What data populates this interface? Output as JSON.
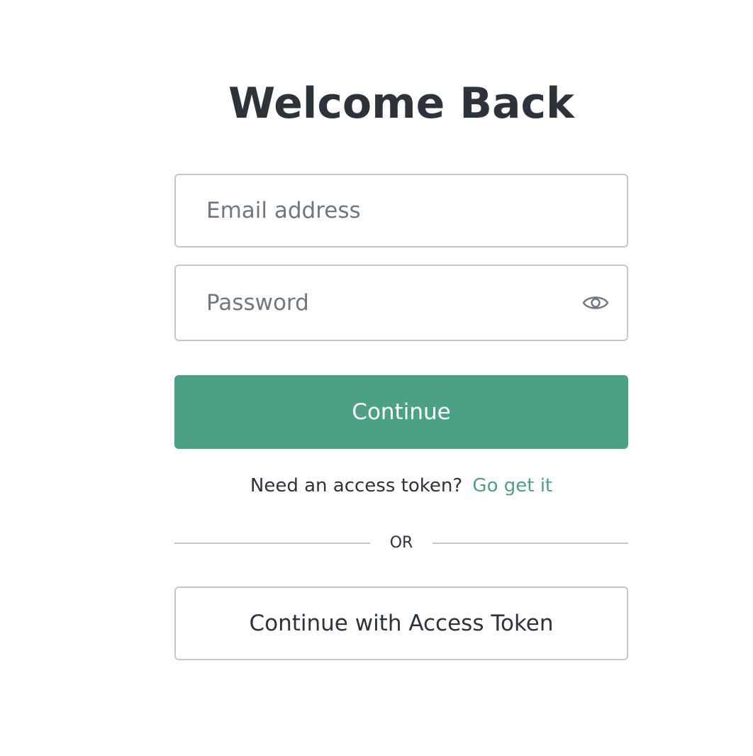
{
  "heading": "Welcome Back",
  "email": {
    "placeholder": "Email address",
    "value": ""
  },
  "password": {
    "placeholder": "Password",
    "value": "",
    "toggle_icon": "eye-icon"
  },
  "continue_label": "Continue",
  "token_prompt": {
    "text": "Need an access token?",
    "link": "Go get it"
  },
  "divider_label": "OR",
  "access_token_button": "Continue with Access Token",
  "colors": {
    "accent": "#4ca182",
    "text": "#2d333a",
    "placeholder": "#6f7780",
    "border": "#c2c8d0"
  }
}
